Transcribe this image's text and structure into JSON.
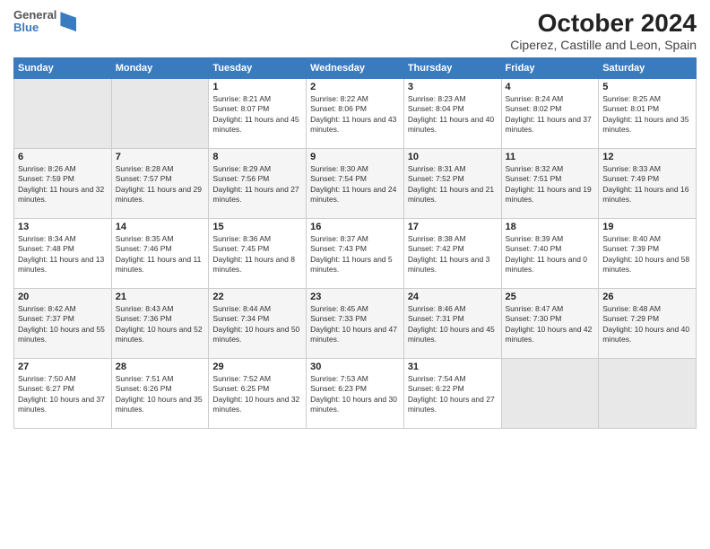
{
  "logo": {
    "line1": "General",
    "line2": "Blue"
  },
  "title": "October 2024",
  "subtitle": "Ciperez, Castille and Leon, Spain",
  "weekdays": [
    "Sunday",
    "Monday",
    "Tuesday",
    "Wednesday",
    "Thursday",
    "Friday",
    "Saturday"
  ],
  "weeks": [
    [
      {
        "day": "",
        "info": ""
      },
      {
        "day": "",
        "info": ""
      },
      {
        "day": "1",
        "info": "Sunrise: 8:21 AM\nSunset: 8:07 PM\nDaylight: 11 hours and 45 minutes."
      },
      {
        "day": "2",
        "info": "Sunrise: 8:22 AM\nSunset: 8:06 PM\nDaylight: 11 hours and 43 minutes."
      },
      {
        "day": "3",
        "info": "Sunrise: 8:23 AM\nSunset: 8:04 PM\nDaylight: 11 hours and 40 minutes."
      },
      {
        "day": "4",
        "info": "Sunrise: 8:24 AM\nSunset: 8:02 PM\nDaylight: 11 hours and 37 minutes."
      },
      {
        "day": "5",
        "info": "Sunrise: 8:25 AM\nSunset: 8:01 PM\nDaylight: 11 hours and 35 minutes."
      }
    ],
    [
      {
        "day": "6",
        "info": "Sunrise: 8:26 AM\nSunset: 7:59 PM\nDaylight: 11 hours and 32 minutes."
      },
      {
        "day": "7",
        "info": "Sunrise: 8:28 AM\nSunset: 7:57 PM\nDaylight: 11 hours and 29 minutes."
      },
      {
        "day": "8",
        "info": "Sunrise: 8:29 AM\nSunset: 7:56 PM\nDaylight: 11 hours and 27 minutes."
      },
      {
        "day": "9",
        "info": "Sunrise: 8:30 AM\nSunset: 7:54 PM\nDaylight: 11 hours and 24 minutes."
      },
      {
        "day": "10",
        "info": "Sunrise: 8:31 AM\nSunset: 7:52 PM\nDaylight: 11 hours and 21 minutes."
      },
      {
        "day": "11",
        "info": "Sunrise: 8:32 AM\nSunset: 7:51 PM\nDaylight: 11 hours and 19 minutes."
      },
      {
        "day": "12",
        "info": "Sunrise: 8:33 AM\nSunset: 7:49 PM\nDaylight: 11 hours and 16 minutes."
      }
    ],
    [
      {
        "day": "13",
        "info": "Sunrise: 8:34 AM\nSunset: 7:48 PM\nDaylight: 11 hours and 13 minutes."
      },
      {
        "day": "14",
        "info": "Sunrise: 8:35 AM\nSunset: 7:46 PM\nDaylight: 11 hours and 11 minutes."
      },
      {
        "day": "15",
        "info": "Sunrise: 8:36 AM\nSunset: 7:45 PM\nDaylight: 11 hours and 8 minutes."
      },
      {
        "day": "16",
        "info": "Sunrise: 8:37 AM\nSunset: 7:43 PM\nDaylight: 11 hours and 5 minutes."
      },
      {
        "day": "17",
        "info": "Sunrise: 8:38 AM\nSunset: 7:42 PM\nDaylight: 11 hours and 3 minutes."
      },
      {
        "day": "18",
        "info": "Sunrise: 8:39 AM\nSunset: 7:40 PM\nDaylight: 11 hours and 0 minutes."
      },
      {
        "day": "19",
        "info": "Sunrise: 8:40 AM\nSunset: 7:39 PM\nDaylight: 10 hours and 58 minutes."
      }
    ],
    [
      {
        "day": "20",
        "info": "Sunrise: 8:42 AM\nSunset: 7:37 PM\nDaylight: 10 hours and 55 minutes."
      },
      {
        "day": "21",
        "info": "Sunrise: 8:43 AM\nSunset: 7:36 PM\nDaylight: 10 hours and 52 minutes."
      },
      {
        "day": "22",
        "info": "Sunrise: 8:44 AM\nSunset: 7:34 PM\nDaylight: 10 hours and 50 minutes."
      },
      {
        "day": "23",
        "info": "Sunrise: 8:45 AM\nSunset: 7:33 PM\nDaylight: 10 hours and 47 minutes."
      },
      {
        "day": "24",
        "info": "Sunrise: 8:46 AM\nSunset: 7:31 PM\nDaylight: 10 hours and 45 minutes."
      },
      {
        "day": "25",
        "info": "Sunrise: 8:47 AM\nSunset: 7:30 PM\nDaylight: 10 hours and 42 minutes."
      },
      {
        "day": "26",
        "info": "Sunrise: 8:48 AM\nSunset: 7:29 PM\nDaylight: 10 hours and 40 minutes."
      }
    ],
    [
      {
        "day": "27",
        "info": "Sunrise: 7:50 AM\nSunset: 6:27 PM\nDaylight: 10 hours and 37 minutes."
      },
      {
        "day": "28",
        "info": "Sunrise: 7:51 AM\nSunset: 6:26 PM\nDaylight: 10 hours and 35 minutes."
      },
      {
        "day": "29",
        "info": "Sunrise: 7:52 AM\nSunset: 6:25 PM\nDaylight: 10 hours and 32 minutes."
      },
      {
        "day": "30",
        "info": "Sunrise: 7:53 AM\nSunset: 6:23 PM\nDaylight: 10 hours and 30 minutes."
      },
      {
        "day": "31",
        "info": "Sunrise: 7:54 AM\nSunset: 6:22 PM\nDaylight: 10 hours and 27 minutes."
      },
      {
        "day": "",
        "info": ""
      },
      {
        "day": "",
        "info": ""
      }
    ]
  ]
}
